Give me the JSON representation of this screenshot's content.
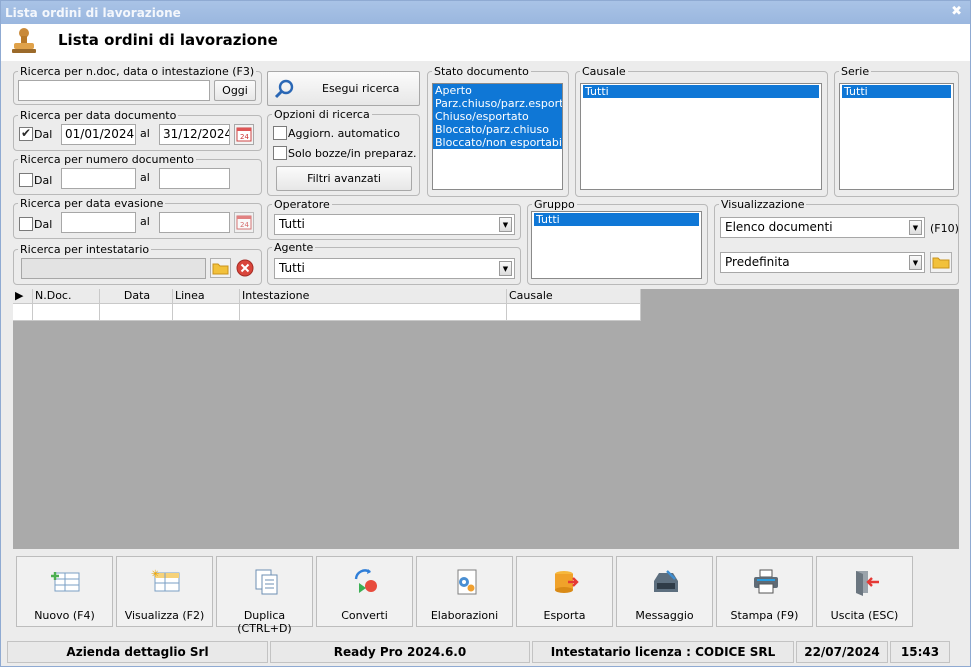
{
  "window": {
    "title": "Lista ordini di lavorazione",
    "close_glyph": "✖"
  },
  "header": {
    "title": "Lista ordini di lavorazione",
    "icon": "stamp-icon"
  },
  "search_text": {
    "legend": "Ricerca per n.doc, data o intestazione (F3)",
    "value": "",
    "today_button": "Oggi"
  },
  "search_button": {
    "label": "Esegui ricerca",
    "icon": "magnifier-icon"
  },
  "date_search": {
    "legend": "Ricerca per data documento",
    "from_checked": true,
    "from_label": "Dal",
    "from": "01/01/2024",
    "to_label": "al",
    "to": "31/12/2024"
  },
  "number_search": {
    "legend": "Ricerca per numero documento",
    "from_checked": false,
    "from_label": "Dal",
    "from": "",
    "to_label": "al",
    "to": ""
  },
  "evasion_search": {
    "legend": "Ricerca per data evasione",
    "from_checked": false,
    "from_label": "Dal",
    "from": "",
    "to_label": "al",
    "to": ""
  },
  "holder_search": {
    "legend": "Ricerca per intestatario",
    "value": ""
  },
  "options": {
    "legend": "Opzioni di ricerca",
    "auto_refresh": "Aggiorn. automatico",
    "auto_refresh_checked": false,
    "drafts_only": "Solo bozze/in preparaz.",
    "drafts_checked": false,
    "advanced_filters": "Filtri avanzati"
  },
  "doc_status": {
    "legend": "Stato documento",
    "items": [
      "Aperto",
      "Parz.chiuso/parz.esportato",
      "Chiuso/esportato",
      "Bloccato/parz.chiuso",
      "Bloccato/non esportabile"
    ]
  },
  "causale": {
    "legend": "Causale",
    "items": [
      "Tutti"
    ]
  },
  "serie": {
    "legend": "Serie",
    "items": [
      "Tutti"
    ]
  },
  "operatore": {
    "legend": "Operatore",
    "value": "Tutti"
  },
  "agente": {
    "legend": "Agente",
    "value": "Tutti"
  },
  "gruppo": {
    "legend": "Gruppo",
    "items": [
      "Tutti"
    ]
  },
  "visualizzazione": {
    "legend": "Visualizzazione",
    "view": "Elenco documenti",
    "shortcut": "(F10)",
    "layout": "Predefinita"
  },
  "table": {
    "columns": [
      "N.Doc.",
      "Data",
      "Linea",
      "Intestazione",
      "Causale"
    ]
  },
  "toolbar": [
    {
      "label": "Nuovo (F4)",
      "icon": "new-document-icon"
    },
    {
      "label": "Visualizza (F2)",
      "icon": "view-grid-icon"
    },
    {
      "label": "Duplica (CTRL+D)",
      "icon": "duplicate-icon"
    },
    {
      "label": "Converti",
      "icon": "convert-icon"
    },
    {
      "label": "Elaborazioni",
      "icon": "processing-gear-icon"
    },
    {
      "label": "Esporta",
      "icon": "export-database-icon"
    },
    {
      "label": "Messaggio",
      "icon": "message-inbox-icon"
    },
    {
      "label": "Stampa (F9)",
      "icon": "printer-icon"
    },
    {
      "label": "Uscita (ESC)",
      "icon": "exit-door-icon"
    }
  ],
  "statusbar": {
    "company": "Azienda dettaglio Srl",
    "version": "Ready Pro 2024.6.0",
    "license": "Intestatario licenza : CODICE SRL",
    "date": "22/07/2024",
    "time": "15:43"
  }
}
